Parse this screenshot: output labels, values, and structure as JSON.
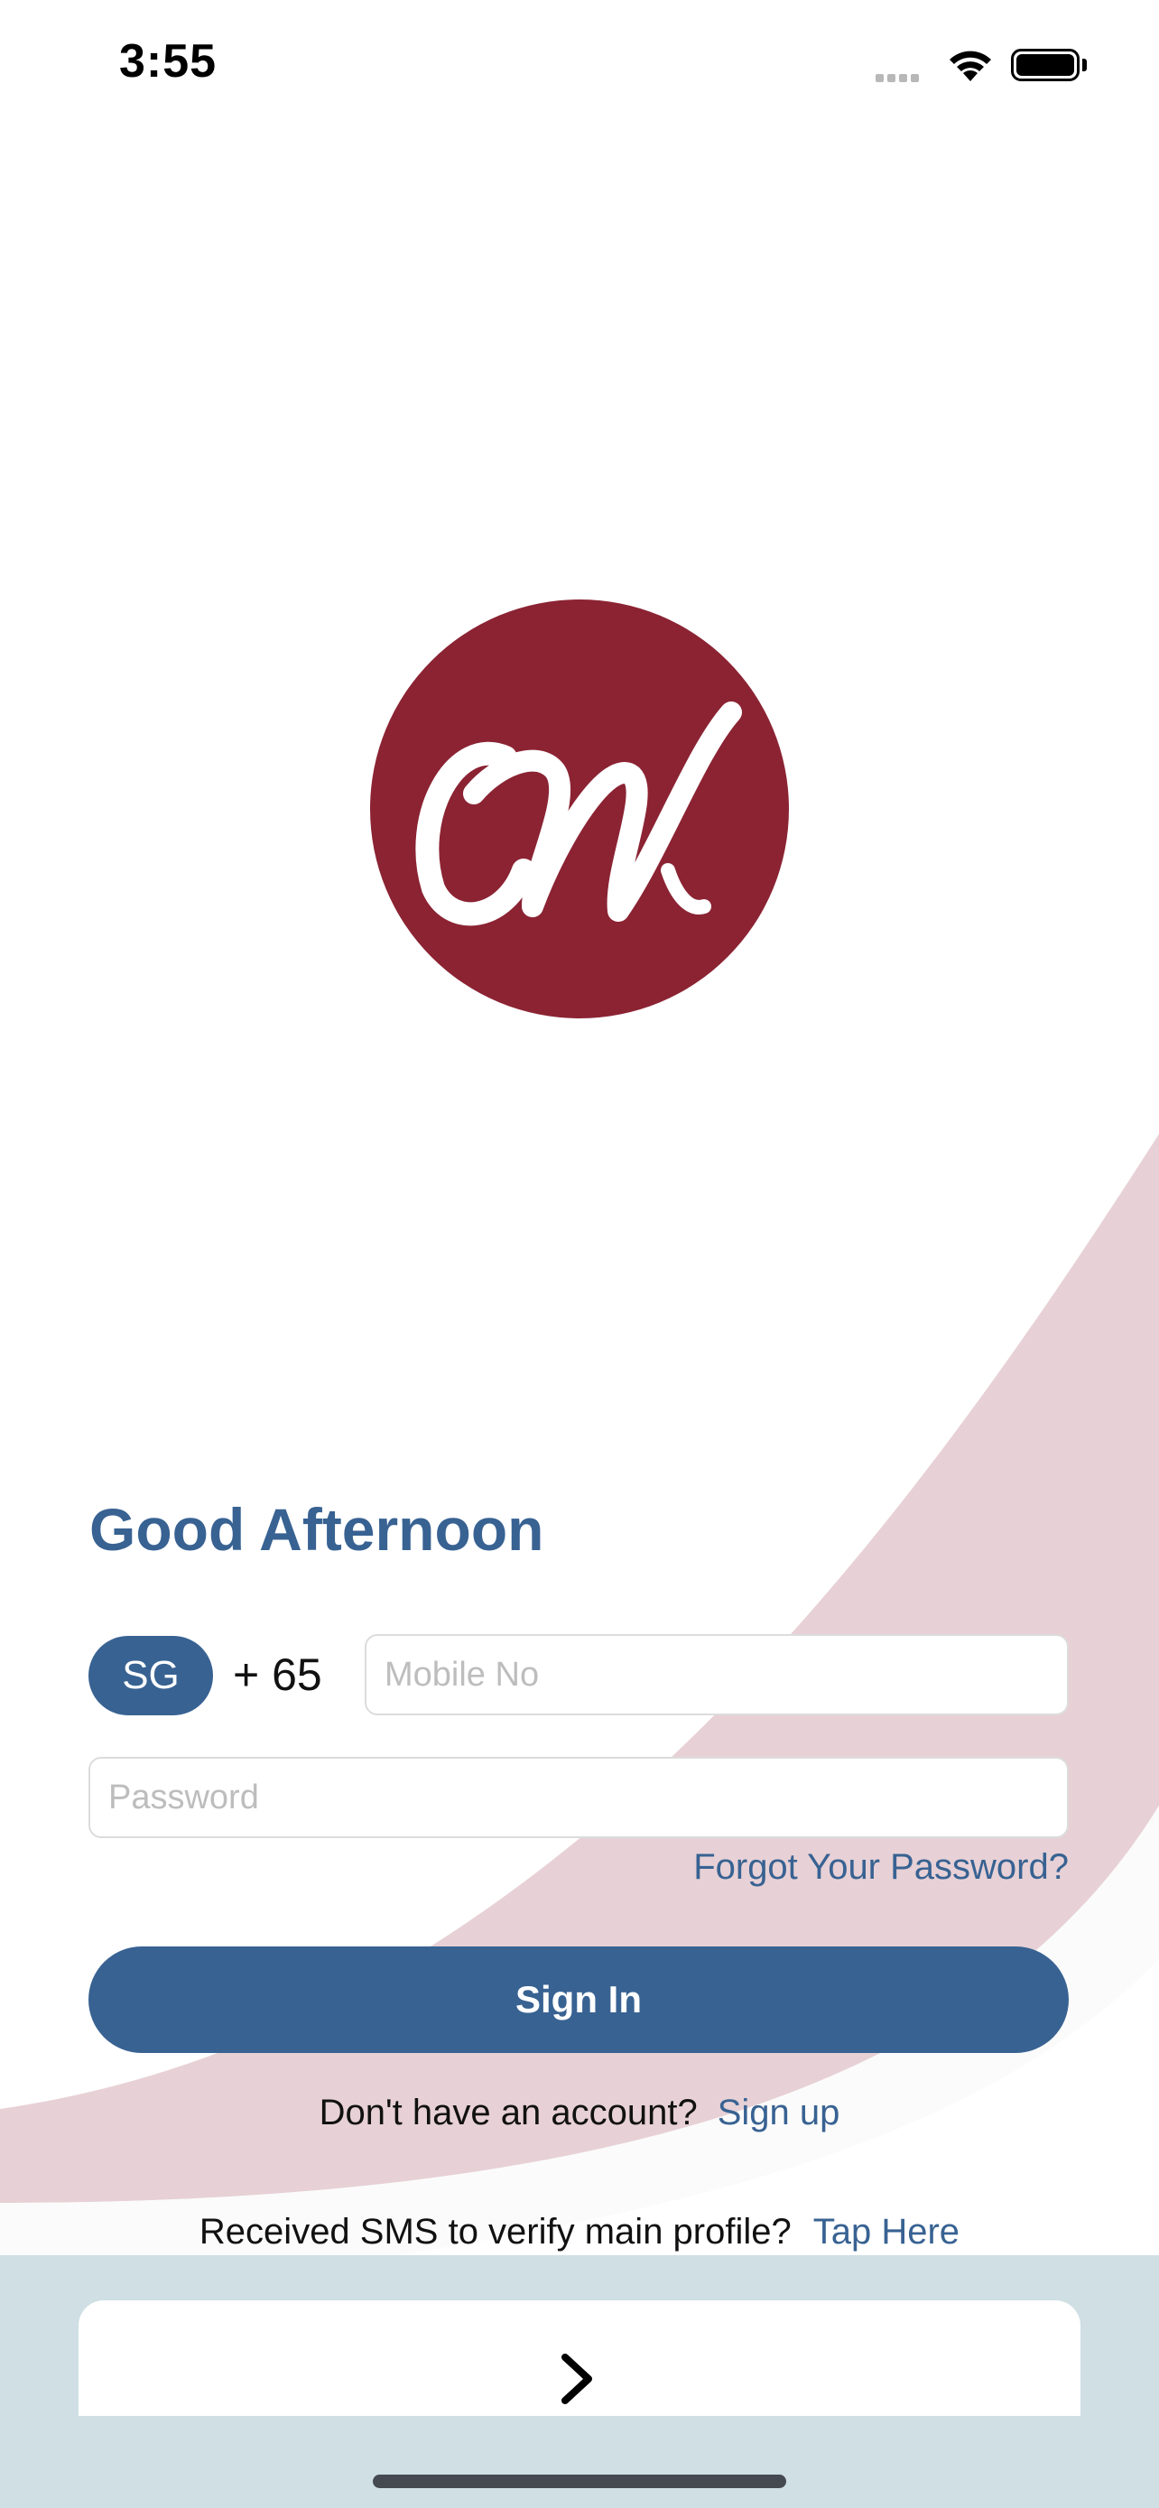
{
  "status_bar": {
    "time": "3:55"
  },
  "greeting": "Good Afternoon",
  "phone": {
    "country": "SG",
    "code": "+ 65",
    "placeholder": "Mobile No"
  },
  "password": {
    "placeholder": "Password"
  },
  "forgot_label": "Forgot Your Password?",
  "signin_label": "Sign In",
  "signup": {
    "prompt": "Don't have an account?",
    "link": "Sign up"
  },
  "sms": {
    "prompt": "Received SMS to verify main profile?",
    "link": "Tap Here"
  },
  "icons": {
    "logo": "script-m-logo",
    "next": "chevron-right-icon"
  },
  "colors": {
    "brand_blue": "#386292",
    "brand_red": "#8b2333",
    "pink_wave": "#e7d1d6",
    "blue_band": "#cfdfe3"
  }
}
